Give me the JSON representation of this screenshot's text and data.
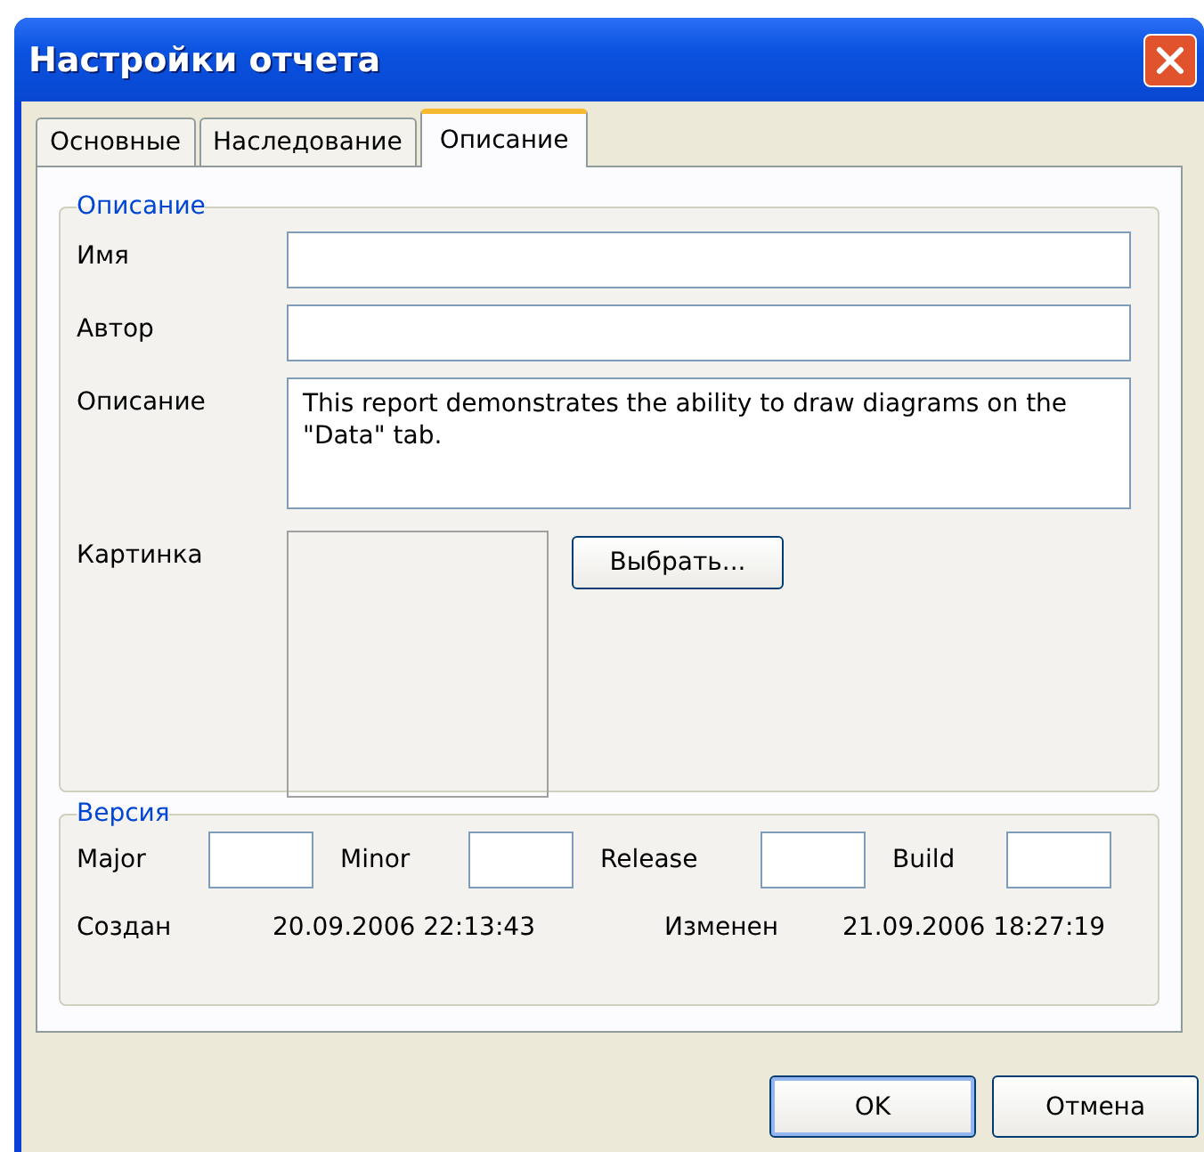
{
  "window": {
    "title": "Настройки отчета"
  },
  "tabs": [
    {
      "label": "Основные",
      "selected": false
    },
    {
      "label": "Наследование",
      "selected": false
    },
    {
      "label": "Описание",
      "selected": true
    }
  ],
  "description_group": {
    "title": "Описание",
    "fields": [
      {
        "label": "Имя",
        "kind": "text"
      },
      {
        "label": "Автор",
        "kind": "text"
      },
      {
        "label": "Описание",
        "kind": "textarea",
        "value": "This report demonstrates the ability to draw diagrams on the \"Data\" tab."
      },
      {
        "label": "Картинка",
        "kind": "picture",
        "button": "Выбрать..."
      }
    ]
  },
  "version_group": {
    "title": "Версия",
    "fields": [
      {
        "label": "Major"
      },
      {
        "label": "Minor"
      },
      {
        "label": "Release"
      },
      {
        "label": "Build"
      }
    ],
    "created_label": "Создан",
    "created": "20.09.2006 22:13:43",
    "modified_label": "Изменен",
    "modified": "21.09.2006 18:27:19"
  },
  "buttons": [
    {
      "label": "OK",
      "default": true
    },
    {
      "label": "Отмена",
      "default": false
    }
  ]
}
